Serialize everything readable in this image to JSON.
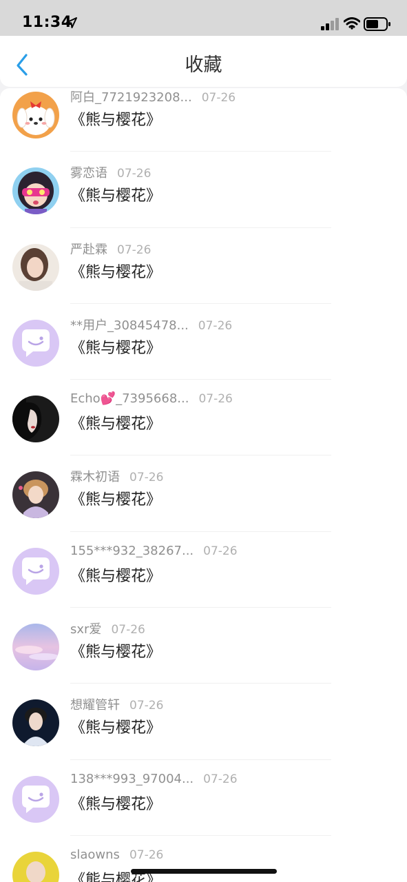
{
  "status_bar": {
    "time": "11:34"
  },
  "header": {
    "title": "收藏"
  },
  "items": [
    {
      "name": "阿白_7721923208...",
      "date": "07-26",
      "work": "《熊与樱花》",
      "avatar": "puppy-cartoon"
    },
    {
      "name": "雾恋语",
      "date": "07-26",
      "work": "《熊与樱花》",
      "avatar": "girl-glasses-cartoon"
    },
    {
      "name": "严赴霖",
      "date": "07-26",
      "work": "《熊与樱花》",
      "avatar": "photo-girl"
    },
    {
      "name": "**用户_30845478...",
      "date": "07-26",
      "work": "《熊与樱花》",
      "avatar": "default-chat"
    },
    {
      "name": "Echo💕_7395668...",
      "date": "07-26",
      "work": "《熊与樱花》",
      "avatar": "photo-dark-profile"
    },
    {
      "name": "霖木初语",
      "date": "07-26",
      "work": "《熊与樱花》",
      "avatar": "photo-girl-hat"
    },
    {
      "name": "155***932_38267...",
      "date": "07-26",
      "work": "《熊与樱花》",
      "avatar": "default-chat"
    },
    {
      "name": "sxr爱",
      "date": "07-26",
      "work": "《熊与樱花》",
      "avatar": "photo-pastel-sky"
    },
    {
      "name": "想耀管轩",
      "date": "07-26",
      "work": "《熊与樱花》",
      "avatar": "photo-boy"
    },
    {
      "name": "138***993_97004...",
      "date": "07-26",
      "work": "《熊与樱花》",
      "avatar": "default-chat"
    },
    {
      "name": "slaowns",
      "date": "07-26",
      "work": "《熊与樱花》",
      "avatar": "photo-yellow"
    }
  ],
  "colors": {
    "accent": "#2a9ee8",
    "default_avatar": "#d9c7f5"
  }
}
